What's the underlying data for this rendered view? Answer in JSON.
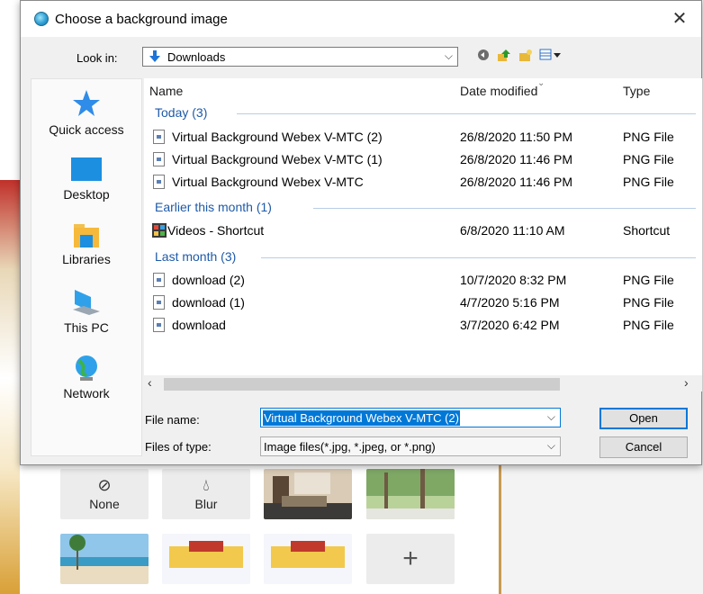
{
  "dialog": {
    "title": "Choose a background image",
    "close_glyph": "✕",
    "look_in_label": "Look in:",
    "look_in_value": "Downloads",
    "toolbar_icons": [
      "back-icon",
      "up-folder-icon",
      "new-folder-icon",
      "view-menu-icon"
    ]
  },
  "places": [
    {
      "label": "Quick access",
      "icon": "star-icon"
    },
    {
      "label": "Desktop",
      "icon": "desktop-icon"
    },
    {
      "label": "Libraries",
      "icon": "libraries-icon"
    },
    {
      "label": "This PC",
      "icon": "computer-icon"
    },
    {
      "label": "Network",
      "icon": "network-icon"
    }
  ],
  "columns": {
    "name": "Name",
    "date": "Date modified",
    "type": "Type"
  },
  "groups": [
    {
      "label": "Today (3)",
      "files": [
        {
          "name": "Virtual Background Webex V-MTC (2)",
          "date": "26/8/2020 11:50 PM",
          "type": "PNG File"
        },
        {
          "name": "Virtual Background Webex V-MTC (1)",
          "date": "26/8/2020 11:46 PM",
          "type": "PNG File"
        },
        {
          "name": "Virtual Background Webex V-MTC",
          "date": "26/8/2020 11:46 PM",
          "type": "PNG File"
        }
      ]
    },
    {
      "label": "Earlier this month (1)",
      "files": [
        {
          "name": "Videos - Shortcut",
          "date": "6/8/2020 11:10 AM",
          "type": "Shortcut"
        }
      ]
    },
    {
      "label": "Last month (3)",
      "files": [
        {
          "name": "download (2)",
          "date": "10/7/2020 8:32 PM",
          "type": "PNG File"
        },
        {
          "name": "download (1)",
          "date": "4/7/2020 5:16 PM",
          "type": "PNG File"
        },
        {
          "name": "download",
          "date": "3/7/2020 6:42 PM",
          "type": "PNG File"
        }
      ]
    }
  ],
  "file_name_label": "File name:",
  "file_name_value": "Virtual Background Webex V-MTC (2)",
  "files_of_type_label": "Files of type:",
  "files_of_type_value": "Image files(*.jpg, *.jpeg, or *.png)",
  "buttons": {
    "open": "Open",
    "cancel": "Cancel"
  },
  "background_options": {
    "none_label": "None",
    "blur_label": "Blur",
    "add_glyph": "+"
  },
  "colors": {
    "accent": "#0078d7",
    "group_text": "#1e5aa8"
  }
}
